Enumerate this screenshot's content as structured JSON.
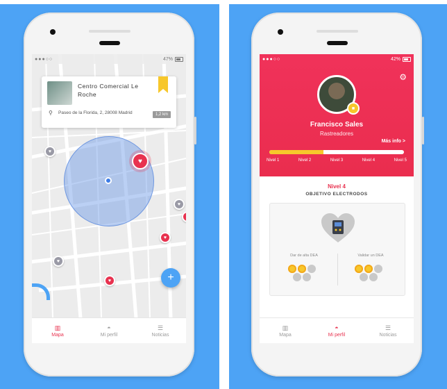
{
  "left_phone": {
    "status": {
      "signal": "●●●○○",
      "battery_pct": "47%"
    },
    "place": {
      "name": "Centro Comercial Le Roche",
      "address": "Paseo de la Florida, 2, 28008 Madrid",
      "distance": "1,2 km"
    },
    "fab_label": "+",
    "tabs": [
      {
        "label": "Mapa",
        "icon": "map-icon",
        "active": true
      },
      {
        "label": "Mi perfil",
        "icon": "profile-icon",
        "active": false
      },
      {
        "label": "Noticias",
        "icon": "news-icon",
        "active": false
      }
    ]
  },
  "right_phone": {
    "status": {
      "signal": "●●●○○",
      "battery_pct": "42%"
    },
    "user": {
      "name": "Francisco Sales",
      "role": "Rastreadores",
      "more_info": "Más info >"
    },
    "progress_fraction": 0.4,
    "levels": [
      "Nivel 1",
      "Nivel 2",
      "Nivel 3",
      "Nivel 4",
      "Nivel 5"
    ],
    "current_level": "Nivel 4",
    "objective": "OBJETIVO ELECTRODOS",
    "goals": [
      {
        "label": "Dar de alta DEA"
      },
      {
        "label": "Validar un DEA"
      }
    ],
    "tabs": [
      {
        "label": "Mapa",
        "icon": "map-icon",
        "active": false
      },
      {
        "label": "Mi perfil",
        "icon": "profile-icon",
        "active": true
      },
      {
        "label": "Noticias",
        "icon": "news-icon",
        "active": false
      }
    ]
  },
  "colors": {
    "background": "#4da3f5",
    "accent": "#e8324f",
    "gold": "#f7c72b"
  }
}
